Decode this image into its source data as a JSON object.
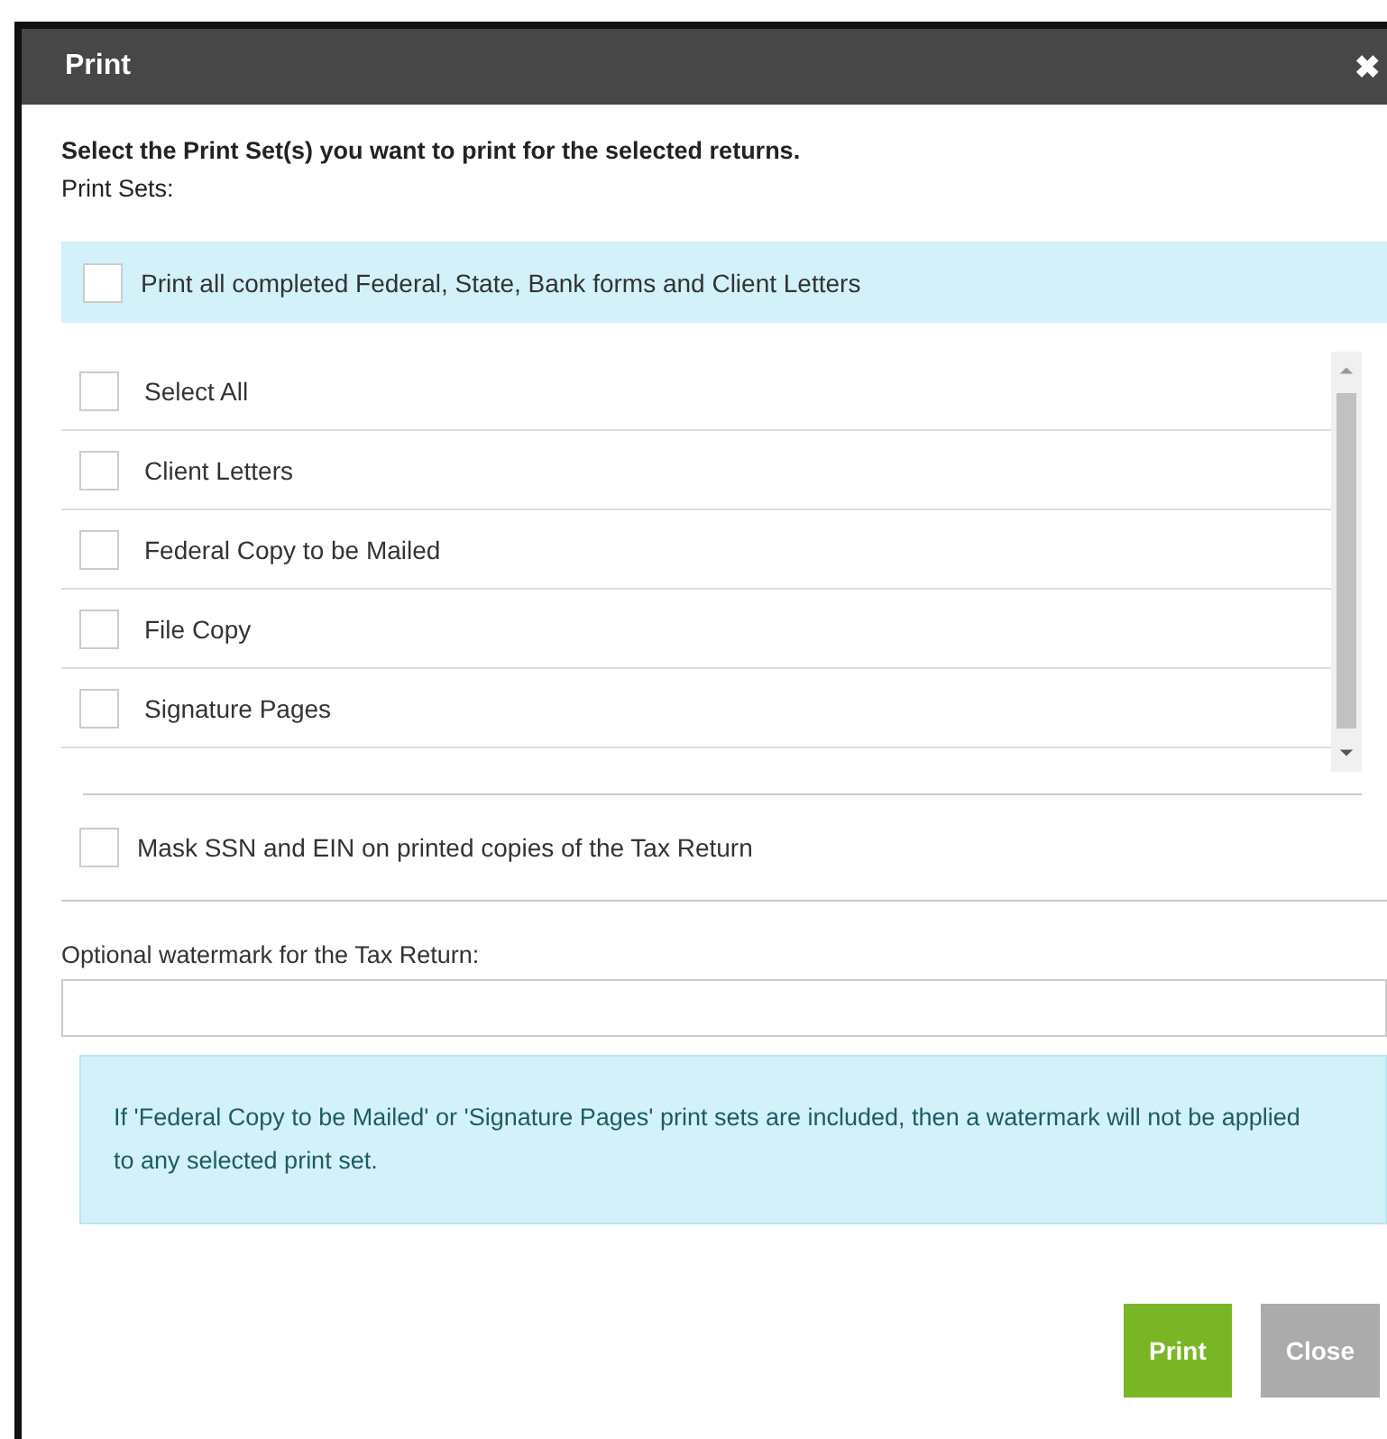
{
  "dialog": {
    "title": "Print",
    "close": "✖"
  },
  "instruction": "Select the Print Set(s) you want to print for the selected returns.",
  "print_sets_label": "Print Sets:",
  "print_all": {
    "label": "Print all completed Federal, State, Bank forms and Client Letters",
    "checked": false
  },
  "print_sets": [
    {
      "label": "Select All",
      "checked": false
    },
    {
      "label": "Client Letters",
      "checked": false
    },
    {
      "label": "Federal Copy to be Mailed",
      "checked": false
    },
    {
      "label": "File Copy",
      "checked": false
    },
    {
      "label": "Signature Pages",
      "checked": false
    }
  ],
  "mask": {
    "label": "Mask SSN and EIN on printed copies of the Tax Return",
    "checked": false
  },
  "watermark": {
    "label": "Optional watermark for the Tax Return:"
  },
  "info": "If 'Federal Copy to be Mailed' or 'Signature Pages' print sets are included, then a watermark will not be applied to any selected print set.",
  "buttons": [
    {
      "label": "Print",
      "kind": "primary"
    },
    {
      "label": "Close",
      "kind": "secondary"
    }
  ]
}
